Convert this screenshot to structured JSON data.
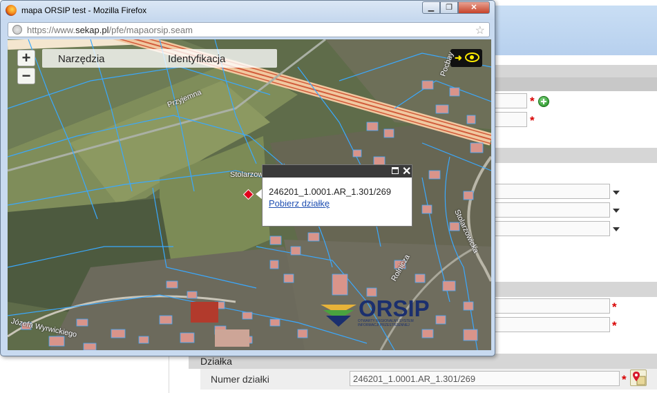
{
  "window": {
    "title": "mapa ORSIP test - Mozilla Firefox",
    "url_prefix": "https://www.",
    "url_domain": "sekap.pl",
    "url_path": "/pfe/mapaorsip.seam",
    "btn_minimize": "▁",
    "btn_maximize": "❐",
    "btn_close": "✕"
  },
  "map": {
    "zoom_in": "+",
    "zoom_out": "−",
    "menu": {
      "tools": "Narzędzia",
      "identify": "Identyfikacja"
    },
    "streets": {
      "przyjemna": "Przyjemna",
      "stolarzowicka_1": "Stolarzow",
      "stolarzowicka_2": "Stolarzowicka",
      "rataja": "Pocbay",
      "rolnicza": "Rolnicza",
      "wyrwickiego": "Józefa Wyrwickiego"
    },
    "popup": {
      "parcel_id": "246201_1.0001.AR_1.301/269",
      "link": "Pobierz działkę"
    },
    "logo": {
      "name": "ORSIP",
      "subtitle_1": "OTWARTY REGIONALNY SYSTEM",
      "subtitle_2": "INFORMACJI PRZESTRZENNEJ"
    },
    "colors": {
      "parcel_lines": "#3aa9ff",
      "highway": "#f1c8a0",
      "marker": "#e0001b"
    }
  },
  "form": {
    "section_title": "Działka",
    "parcel_number_label": "Numer działki",
    "parcel_number_value": "246201_1.0001.AR_1.301/269",
    "required_mark": "*"
  }
}
